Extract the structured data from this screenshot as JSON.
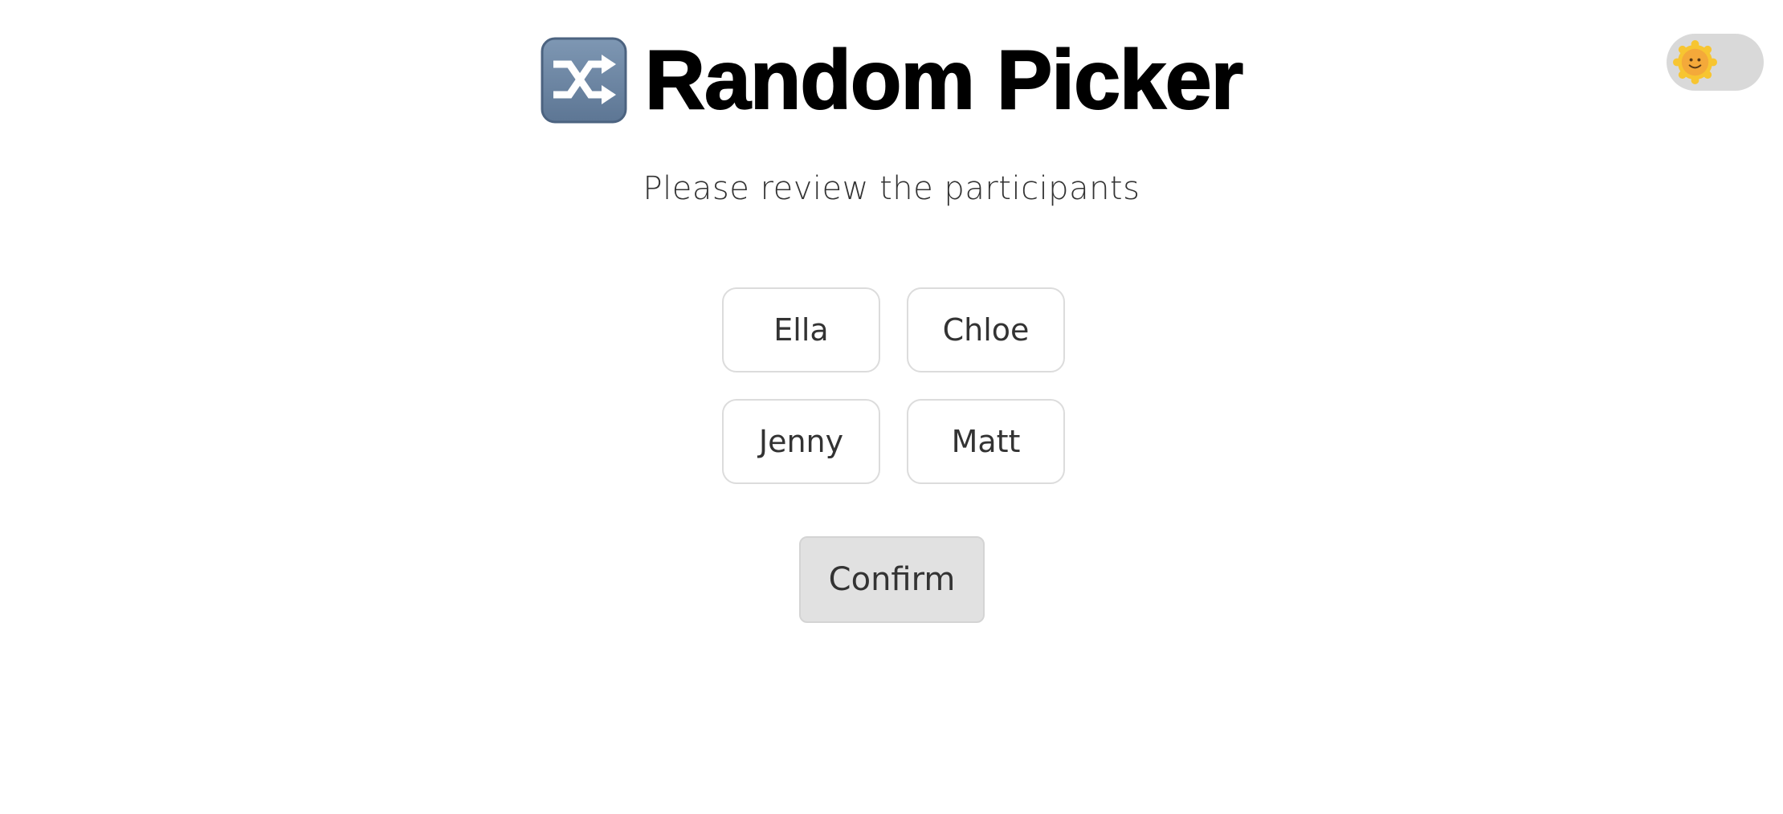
{
  "app": {
    "title": "Random Picker",
    "title_icon": "shuffle-icon"
  },
  "theme_toggle": {
    "icon": "sun-face-icon",
    "state": "light"
  },
  "subtitle": "Please review the participants",
  "participants": [
    {
      "name": "Ella"
    },
    {
      "name": "Chloe"
    },
    {
      "name": "Jenny"
    },
    {
      "name": "Matt"
    }
  ],
  "confirm": {
    "label": "Confirm"
  },
  "colors": {
    "toggle_track": "#d9d9d9",
    "sun": "#f7c531",
    "shuffle_icon_bg": "#6f87a3",
    "button_bg": "#e1e1e1",
    "card_border": "#dcdcdc"
  }
}
